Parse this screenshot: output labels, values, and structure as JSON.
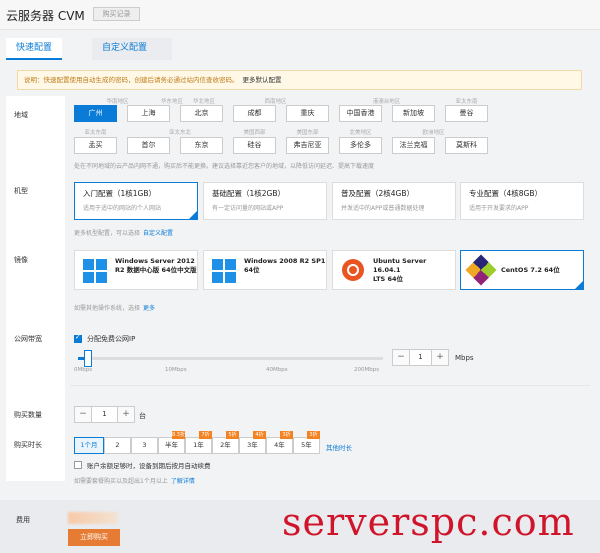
{
  "header": {
    "title": "云服务器 CVM",
    "buy_tag": "购买记录"
  },
  "tabs": [
    {
      "label": "快速配置"
    },
    {
      "label": "自定义配置"
    }
  ],
  "notice": {
    "text": "说明：快速配置使用自动生成的密码，创建后请务必通过站内信查收密码。",
    "link": "更多默认配置"
  },
  "labels": {
    "region": "地域",
    "model": "机型",
    "image": "镜像",
    "bandwidth": "公网带宽",
    "quantity": "购买数量",
    "duration": "购买时长",
    "fee": "费用"
  },
  "region": {
    "row1_groups": [
      "华南地区",
      "华东地区",
      "华北地区",
      "西南地区",
      "港澳台地区",
      "亚太东南"
    ],
    "row1": [
      "广州",
      "上海",
      "北京",
      "成都",
      "重庆",
      "中国香港",
      "新加坡",
      "曼谷"
    ],
    "row2_groups": [
      "亚太东南",
      "亚太东北",
      "美国西部",
      "美国东部",
      "北美地区",
      "欧洲地区"
    ],
    "row2": [
      "孟买",
      "首尔",
      "东京",
      "硅谷",
      "弗吉尼亚",
      "多伦多",
      "法兰克福",
      "莫斯科"
    ],
    "selected": "广州",
    "hint": "处在不同地域的云产品内网不通，购买后不能更换。建议选择靠近您客户的地域，以降低访问延迟、提高下载速度"
  },
  "models": [
    {
      "title": "入门配置（1核1GB）",
      "desc": "适用于适中的网站的个人网站"
    },
    {
      "title": "基础配置（1核2GB）",
      "desc": "有一定访问量的网站或APP"
    },
    {
      "title": "普及配置（2核4GB）",
      "desc": "并发适中的APP或普通数据处理"
    },
    {
      "title": "专业配置（4核8GB）",
      "desc": "适用于开发要求的APP"
    }
  ],
  "model_hint": {
    "text": "更多机型配置，可以选择",
    "link": "自定义配置"
  },
  "images": [
    {
      "line1": "Windows Server 2012",
      "line2": "R2 数据中心版 64位中文版"
    },
    {
      "line1": "Windows 2008 R2 SP1",
      "line2": "64位"
    },
    {
      "line1": "Ubuntu Server 16.04.1",
      "line2": "LTS 64位"
    },
    {
      "line1": "CentOS 7.2 64位",
      "line2": ""
    }
  ],
  "image_hint": {
    "text": "如需其他操作系统，选择",
    "link": "更多"
  },
  "bandwidth": {
    "checkbox_label": "分配免费公网IP",
    "ticks": [
      "0Mbps",
      "10Mbps",
      "40Mbps",
      "200Mbps"
    ],
    "value": "1",
    "unit": "Mbps",
    "level": 1
  },
  "quantity": {
    "value": "1",
    "unit": "台"
  },
  "duration": {
    "options": [
      "1个月",
      "2",
      "3",
      "半年",
      "1年",
      "2年",
      "3年",
      "4年",
      "5年"
    ],
    "discounts": [
      "8.3折",
      "7折",
      "5折",
      "4折",
      "3折",
      "3折"
    ],
    "selected": "1个月",
    "more": "其他时长",
    "auto_renew": "账户余额足够时，设备到期后按月自动续费",
    "note": "如需要套餐购买以及超出1个月以上",
    "note_link": "了解详情"
  },
  "footer": {
    "buy": "立即购买"
  },
  "watermark": "serverspc.com",
  "colors": {
    "accent": "#0a7bd6",
    "orange": "#e67b34",
    "notice_bg": "#fff8e6"
  }
}
